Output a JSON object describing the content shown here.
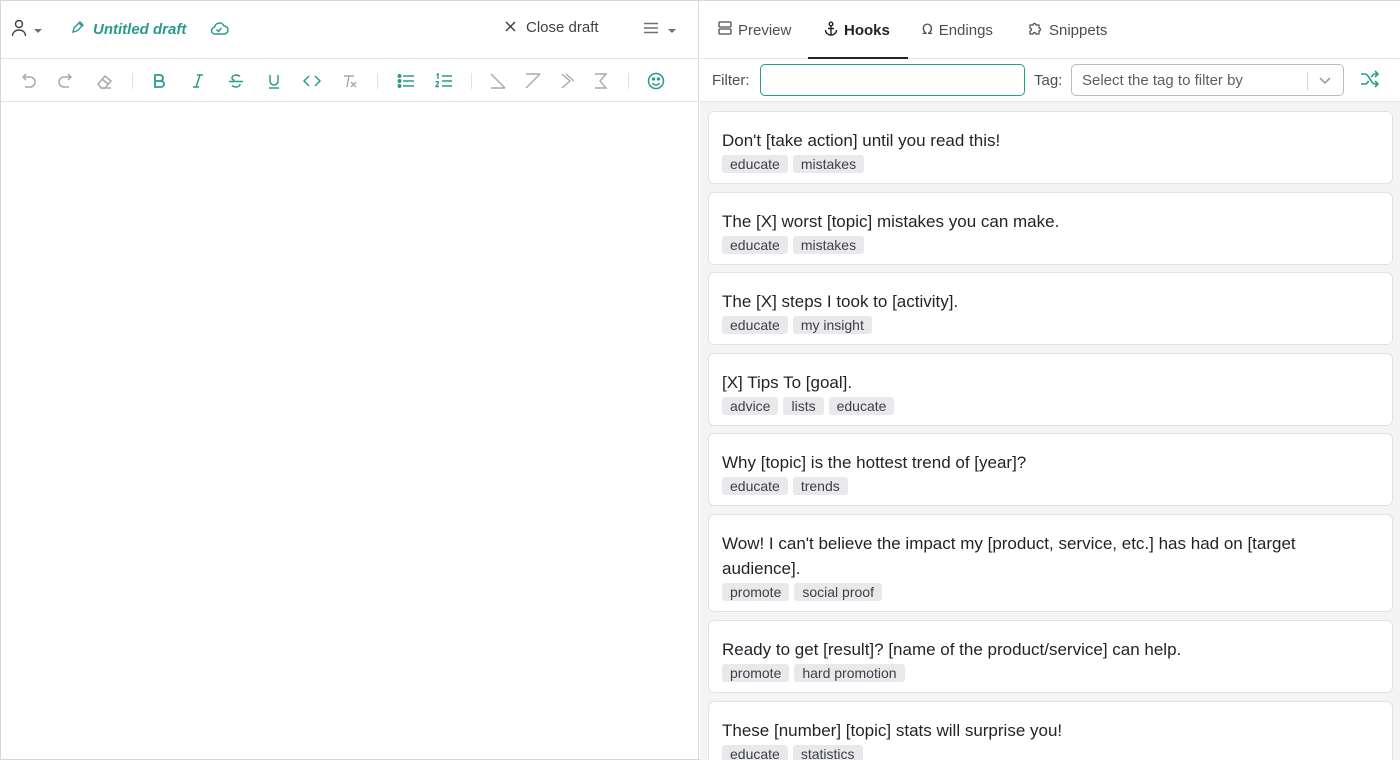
{
  "header": {
    "draft_title": "Untitled draft",
    "close_label": "Close draft"
  },
  "toolbar": {
    "buttons": [
      {
        "icon": "undo-icon",
        "state": "disabled"
      },
      {
        "icon": "redo-icon",
        "state": "disabled"
      },
      {
        "icon": "eraser-icon",
        "state": "disabled"
      },
      {
        "icon": "bold-icon",
        "state": "enabled"
      },
      {
        "icon": "italic-icon",
        "state": "enabled"
      },
      {
        "icon": "strikethrough-icon",
        "state": "enabled"
      },
      {
        "icon": "underline-icon",
        "state": "enabled"
      },
      {
        "icon": "code-icon",
        "state": "enabled"
      },
      {
        "icon": "clear-format-icon",
        "state": "disabled"
      },
      {
        "icon": "bullet-list-icon",
        "state": "enabled"
      },
      {
        "icon": "numbered-list-icon",
        "state": "enabled"
      },
      {
        "icon": "line-style-1-icon",
        "state": "disabled"
      },
      {
        "icon": "line-style-2-icon",
        "state": "disabled"
      },
      {
        "icon": "line-style-3-icon",
        "state": "disabled"
      },
      {
        "icon": "line-style-4-icon",
        "state": "disabled"
      },
      {
        "icon": "emoji-icon",
        "state": "enabled"
      }
    ]
  },
  "tabs": [
    {
      "label": "Preview",
      "icon": "preview-icon",
      "active": false
    },
    {
      "label": "Hooks",
      "icon": "anchor-icon",
      "active": true
    },
    {
      "label": "Endings",
      "icon": "omega-icon",
      "active": false
    },
    {
      "label": "Snippets",
      "icon": "puzzle-icon",
      "active": false
    }
  ],
  "filter": {
    "label": "Filter:",
    "value": "",
    "tag_label": "Tag:",
    "tag_placeholder": "Select the tag to filter by"
  },
  "hooks": [
    {
      "text": "Don't [take action] until you read this!",
      "tags": [
        "educate",
        "mistakes"
      ]
    },
    {
      "text": "The [X] worst [topic] mistakes you can make.",
      "tags": [
        "educate",
        "mistakes"
      ]
    },
    {
      "text": "The [X] steps I took to [activity].",
      "tags": [
        "educate",
        "my insight"
      ]
    },
    {
      "text": "[X] Tips To [goal].",
      "tags": [
        "advice",
        "lists",
        "educate"
      ]
    },
    {
      "text": "Why [topic] is the hottest trend of [year]?",
      "tags": [
        "educate",
        "trends"
      ]
    },
    {
      "text": "Wow! I can't believe the impact my [product, service, etc.] has had on [target audience].",
      "tags": [
        "promote",
        "social proof"
      ]
    },
    {
      "text": "Ready to get [result]? [name of the product/service] can help.",
      "tags": [
        "promote",
        "hard promotion"
      ]
    },
    {
      "text": "These [number] [topic] stats will surprise you!",
      "tags": [
        "educate",
        "statistics"
      ]
    }
  ],
  "colors": {
    "accent": "#2a9a8c",
    "text": "#1f2328",
    "chip_bg": "#e9e9eb",
    "panel_bg": "#f4f4f5"
  }
}
